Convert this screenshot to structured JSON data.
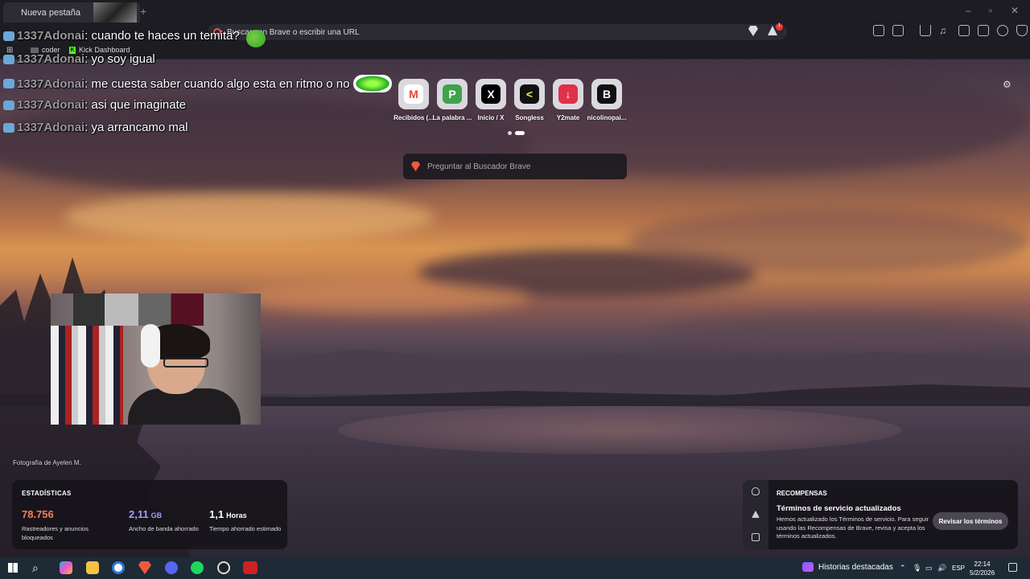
{
  "browser": {
    "tab_title": "Nueva pestaña",
    "address_placeholder": "Buscar con Brave o escribir una URL",
    "shields_count": "1",
    "bookmarks": [
      {
        "label": "coder"
      },
      {
        "label": "Kick Dashboard"
      }
    ]
  },
  "chat": {
    "messages": [
      {
        "user": "1337Adonai",
        "text": "cuando te haces un temita?"
      },
      {
        "user": "1337Adonai",
        "text": "yo soy igual"
      },
      {
        "user": "1337Adonai",
        "text": "me cuesta saber cuando algo esta en ritmo o no"
      },
      {
        "user": "1337Adonai",
        "text": "asi que imaginate"
      },
      {
        "user": "1337Adonai",
        "text": "ya arrancamo mal"
      }
    ]
  },
  "newtab": {
    "tiles": [
      {
        "label": "Recibidos (...",
        "glyph": "M",
        "color": "#ea4335"
      },
      {
        "label": "La palabra ...",
        "glyph": "P",
        "color": "#3fa34d"
      },
      {
        "label": "Inicio / X",
        "glyph": "X",
        "color": "#000000"
      },
      {
        "label": "Songless",
        "glyph": "<",
        "color": "#111111"
      },
      {
        "label": "Y2mate",
        "glyph": "↓",
        "color": "#e0304a"
      },
      {
        "label": "nicolinopai...",
        "glyph": "B",
        "color": "#111111"
      }
    ],
    "search_placeholder": "Preguntar al Buscador Brave",
    "photo_credit": "Fotografía de Ayelen M."
  },
  "stats": {
    "title": "ESTADÍSTICAS",
    "items": [
      {
        "value": "78.756",
        "unit": "",
        "desc": "Rastreadores y anuncios bloqueados",
        "color": "#ff7a59"
      },
      {
        "value": "2,11",
        "unit": "GB",
        "desc": "Ancho de banda ahorrado",
        "color": "#a89bff"
      },
      {
        "value": "1,1",
        "unit": "Horas",
        "desc": "Tiempo ahorrado estimado",
        "color": "#ffffff"
      }
    ]
  },
  "rewards": {
    "title": "RECOMPENSAS",
    "heading": "Términos de servicio actualizados",
    "body": "Hemos actualizado los Términos de servicio. Para seguir usando las Recompensas de Brave, revisa y acepta los términos actualizados.",
    "button": "Revisar los términos"
  },
  "taskbar": {
    "news": "Historias destacadas",
    "language": "ESP",
    "time": "22:14",
    "date": "5/2/2026"
  }
}
